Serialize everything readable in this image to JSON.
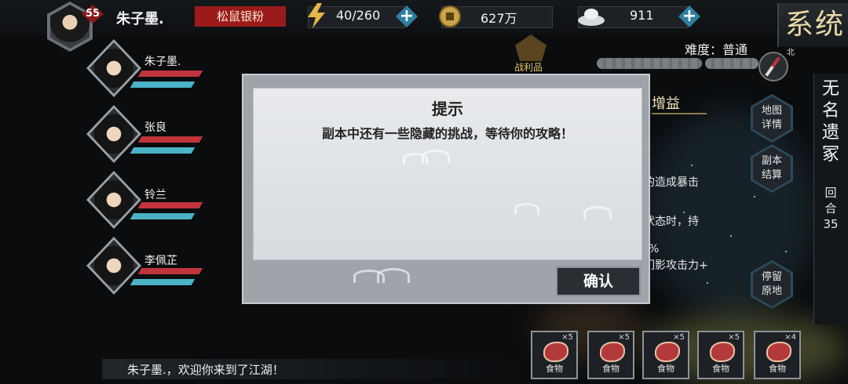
{
  "player": {
    "level": "55",
    "name": "朱子墨.",
    "rank": "松鼠银粉"
  },
  "resources": {
    "stamina": "40/260",
    "coins": "627万",
    "ingots": "911"
  },
  "system_label": "系统",
  "party": [
    {
      "name": "朱子墨."
    },
    {
      "name": "张良"
    },
    {
      "name": "铃兰"
    },
    {
      "name": "李佩芷"
    }
  ],
  "map": {
    "loot_label": "战利品",
    "difficulty": "难度：普通",
    "north": "北",
    "dungeon_name": "无名遗冢",
    "round": "回合35"
  },
  "side_buttons": [
    "地图详情",
    "副本结算",
    "停留原地"
  ],
  "buff": {
    "title": "增益",
    "lines": [
      "的造成暴击",
      "状态时，持",
      "%",
      "们影攻击力+"
    ]
  },
  "dialog": {
    "title": "提示",
    "message": "副本中还有一些隐藏的挑战，等待你的攻略！",
    "confirm": "确认"
  },
  "chat": {
    "message": "朱子墨.，欢迎你来到了江湖！"
  },
  "items": [
    {
      "label": "食物",
      "count": "×5"
    },
    {
      "label": "食物",
      "count": "×5"
    },
    {
      "label": "食物",
      "count": "×5"
    },
    {
      "label": "食物",
      "count": "×5"
    },
    {
      "label": "食物",
      "count": "×4"
    }
  ]
}
